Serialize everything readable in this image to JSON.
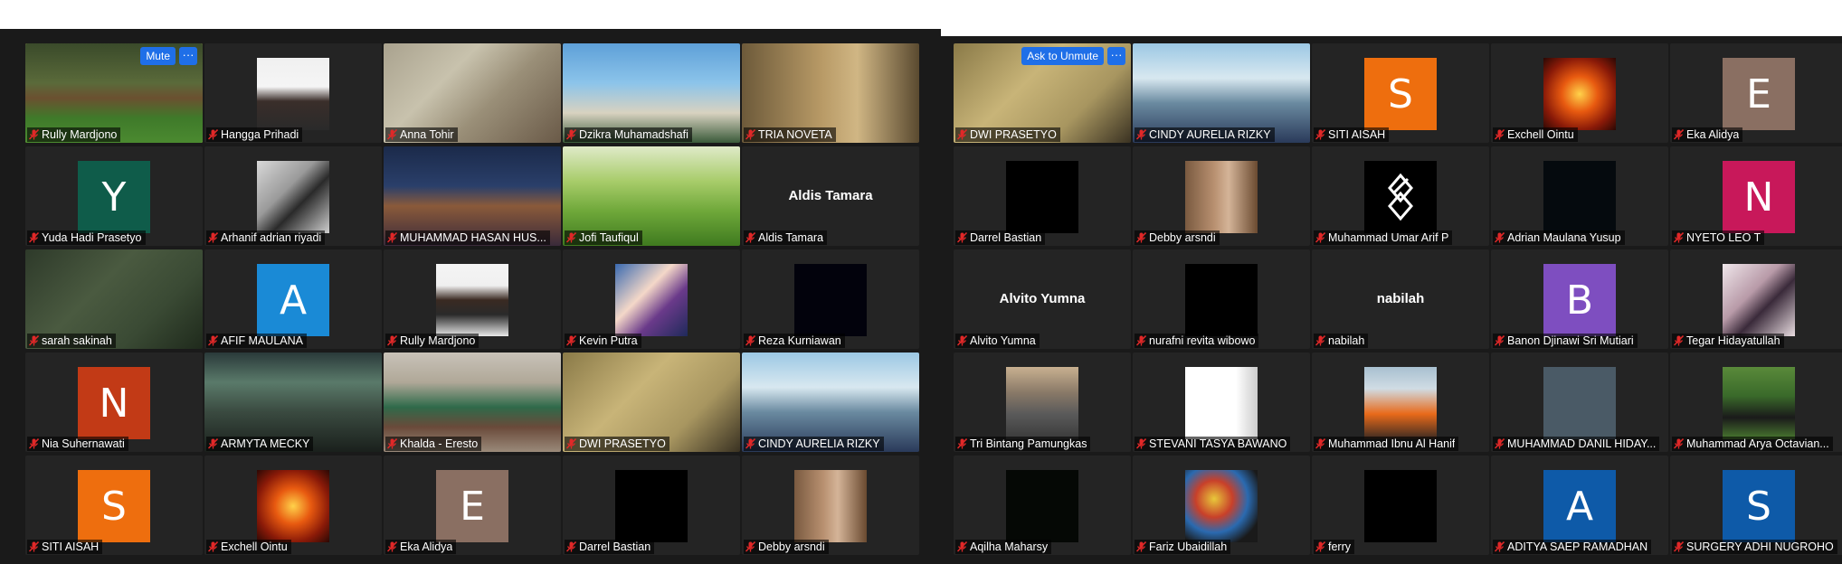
{
  "left_panel": {
    "mute_button_label": "Mute",
    "more_button_label": "···",
    "tiles": [
      {
        "name": "Rully Mardjono",
        "kind": "video",
        "active": true,
        "bg": "linear-gradient(180deg,#3a4a2a 0%,#5a6a3a 40%,#6b5030 55%,#3f7a2a 75%,#4b8a30 100%)"
      },
      {
        "name": "Hangga Prihadi",
        "kind": "image",
        "bg": "linear-gradient(180deg,#f0f0f0 0%,#f5f5f5 40%,#3a2e2a 60%,#2a2a2a 100%)"
      },
      {
        "name": "Anna Tohir",
        "kind": "video",
        "bg": "linear-gradient(135deg,#a9a28e 0%,#c8c2ad 35%,#9a8f78 60%,#6a5a48 100%)"
      },
      {
        "name": "Dzikra Muhamadshafi",
        "kind": "video",
        "bg": "linear-gradient(180deg,#5ea0d8 0%,#8cc4ea 40%,#d8d2c0 70%,#3a5a3a 100%)"
      },
      {
        "name": "TRIA NOVETA",
        "kind": "video",
        "bg": "linear-gradient(90deg,#6d5a3a 0%,#b89a66 45%,#d0b684 65%,#5a4a30 100%)"
      },
      {
        "name": "Yuda Hadi Prasetyo",
        "kind": "avatar",
        "letter": "Y",
        "color": "#0f5c4a"
      },
      {
        "name": "Arhanif adrian riyadi",
        "kind": "image",
        "bg": "linear-gradient(135deg,#d8d8d8 0%,#9a9a9a 40%,#2a2a2a 60%,#cfcfcf 100%)"
      },
      {
        "name": "MUHAMMAD HASAN HUS...",
        "kind": "video",
        "bg": "linear-gradient(180deg,#1b2a4a 0%,#2a3f6a 40%,#8a5a3a 60%,#3a2a3a 100%)"
      },
      {
        "name": "Jofi Taufiqul",
        "kind": "video",
        "bg": "linear-gradient(180deg,#dfeac8 0%,#a8cc6a 35%,#6fa83a 65%,#3f7a1f 100%)"
      },
      {
        "name": "Aldis Tamara",
        "kind": "text",
        "label": "Aldis Tamara"
      },
      {
        "name": "sarah sakinah",
        "kind": "video",
        "bg": "linear-gradient(135deg,#2e3a2a 0%,#4a5a40 40%,#3a4a34 70%,#1f2a1c 100%)"
      },
      {
        "name": "AFIF MAULANA",
        "kind": "avatar",
        "letter": "A",
        "color": "#1a8ad6"
      },
      {
        "name": "Rully Mardjono",
        "kind": "image",
        "bg": "linear-gradient(180deg,#f4f4f4 0%,#f0f0f0 30%,#3a2a22 50%,#2a2a2a 70%,#e8e8e8 100%)"
      },
      {
        "name": "Kevin Putra",
        "kind": "image",
        "bg": "linear-gradient(135deg,#3a6ab0 0%,#f4d8c8 40%,#6a3a8a 65%,#1f2a5a 100%)"
      },
      {
        "name": "Reza Kurniawan",
        "kind": "image",
        "bg": "#02020c"
      },
      {
        "name": "Nia Suhernawati",
        "kind": "avatar",
        "letter": "N",
        "color": "#c23a16"
      },
      {
        "name": "ARMYTA MECKY",
        "kind": "video",
        "bg": "linear-gradient(180deg,#2a3a3a 0%,#5a7a6a 30%,#3a4a40 60%,#1a201c 100%)"
      },
      {
        "name": "Khalda - Eresto",
        "kind": "video",
        "bg": "linear-gradient(180deg,#c8c2b8 0%,#b0a898 30%,#2f6a4a 55%,#6a4a3a 75%,#9a8a7a 100%)"
      },
      {
        "name": "DWI PRASETYO",
        "kind": "video",
        "bg": "linear-gradient(135deg,#8a7a48 0%,#c8b478 40%,#a89660 70%,#3a3222 100%)"
      },
      {
        "name": "CINDY AURELIA RIZKY",
        "kind": "video",
        "bg": "linear-gradient(180deg,#9cc8e4 0%,#d8e8f0 35%,#6a8aa0 60%,#2a3a5a 100%)"
      },
      {
        "name": "SITI AISAH",
        "kind": "avatar",
        "letter": "S",
        "color": "#ee6e0e"
      },
      {
        "name": "Exchell Ointu",
        "kind": "image",
        "bg": "radial-gradient(circle at 50% 50%,#ffd24a 0%,#e85a10 35%,#8a1a08 70%,#2a0804 100%)"
      },
      {
        "name": "Eka Alidya",
        "kind": "avatar",
        "letter": "E",
        "color": "#8a6f62"
      },
      {
        "name": "Darrel Bastian",
        "kind": "image",
        "bg": "#000000"
      },
      {
        "name": "Debby arsndi",
        "kind": "image",
        "bg": "linear-gradient(90deg,#7a5a40 0%,#b89070 40%,#d4b498 60%,#6a4a30 100%)"
      }
    ]
  },
  "right_panel": {
    "ask_unmute_label": "Ask to Unmute",
    "more_button_label": "···",
    "tiles": [
      {
        "name": "DWI PRASETYO",
        "kind": "video",
        "bg": "linear-gradient(135deg,#8a7a48 0%,#c8b478 40%,#a89660 70%,#3a3222 100%)"
      },
      {
        "name": "CINDY AURELIA RIZKY",
        "kind": "video",
        "bg": "linear-gradient(180deg,#9cc8e4 0%,#d8e8f0 35%,#6a8aa0 60%,#2a3a5a 100%)"
      },
      {
        "name": "SITI AISAH",
        "kind": "avatar",
        "letter": "S",
        "color": "#ee6e0e"
      },
      {
        "name": "Exchell Ointu",
        "kind": "image",
        "bg": "radial-gradient(circle at 50% 50%,#ffd24a 0%,#e85a10 35%,#8a1a08 70%,#2a0804 100%)"
      },
      {
        "name": "Eka Alidya",
        "kind": "avatar",
        "letter": "E",
        "color": "#8a6f62"
      },
      {
        "name": "Darrel Bastian",
        "kind": "image",
        "bg": "#000000"
      },
      {
        "name": "Debby arsndi",
        "kind": "image",
        "bg": "linear-gradient(90deg,#7a5a40 0%,#b89070 40%,#d4b498 60%,#6a4a30 100%)"
      },
      {
        "name": "Muhammad Umar Arif P",
        "kind": "logo"
      },
      {
        "name": "Adrian Maulana Yusup",
        "kind": "image",
        "bg": "#050a0e"
      },
      {
        "name": "NYETO LEO T",
        "kind": "avatar",
        "letter": "N",
        "color": "#c8185a"
      },
      {
        "name": "Alvito Yumna",
        "kind": "text",
        "label": "Alvito Yumna"
      },
      {
        "name": "nurafni revita wibowo",
        "kind": "image",
        "bg": "#000000"
      },
      {
        "name": "nabilah",
        "kind": "text",
        "label": "nabilah"
      },
      {
        "name": "Banon Djinawi Sri Mutiari",
        "kind": "avatar",
        "letter": "B",
        "color": "#7e4ec0"
      },
      {
        "name": "Tegar Hidayatullah",
        "kind": "image",
        "bg": "linear-gradient(135deg,#efe6ea 0%,#b89aa8 40%,#3a2a3a 60%,#e8dce0 100%)"
      },
      {
        "name": "Tri Bintang Pamungkas",
        "kind": "image",
        "bg": "linear-gradient(180deg,#c8b090 0%,#8a7a68 35%,#5a5a5a 65%,#3a3a3a 100%)"
      },
      {
        "name": "STEVANI TASYA BAWANO",
        "kind": "image",
        "bg": "linear-gradient(90deg,#ffffff 0%,#ffffff 70%,#cccccc 100%)"
      },
      {
        "name": "Muhammad Ibnu Al Hanif",
        "kind": "image",
        "bg": "linear-gradient(180deg,#a8c0d0 0%,#d0dce4 30%,#e86a1a 65%,#3a2a22 100%)"
      },
      {
        "name": "MUHAMMAD DANIL HIDAY...",
        "kind": "image",
        "bg": "#4a5a66"
      },
      {
        "name": "Muhammad Arya Octavian...",
        "kind": "image",
        "bg": "linear-gradient(180deg,#5a8a3a 0%,#3a6a2a 40%,#1a1a1a 70%,#4a7a30 100%)"
      },
      {
        "name": "Aqilha Maharsy",
        "kind": "image",
        "bg": "#050805"
      },
      {
        "name": "Fariz Ubaidillah",
        "kind": "image",
        "bg": "radial-gradient(circle at 40% 40%,#e8c83a 0%,#c8402a 30%,#2a6ab0 55%,#1a1a1a 80%)"
      },
      {
        "name": "ferry",
        "kind": "image",
        "bg": "#000000"
      },
      {
        "name": "ADITYA SAEP RAMADHAN",
        "kind": "avatar",
        "letter": "A",
        "color": "#0e5aa8"
      },
      {
        "name": "SURGERY ADHI NUGROHO",
        "kind": "avatar",
        "letter": "S",
        "color": "#0e5aa8"
      }
    ]
  }
}
